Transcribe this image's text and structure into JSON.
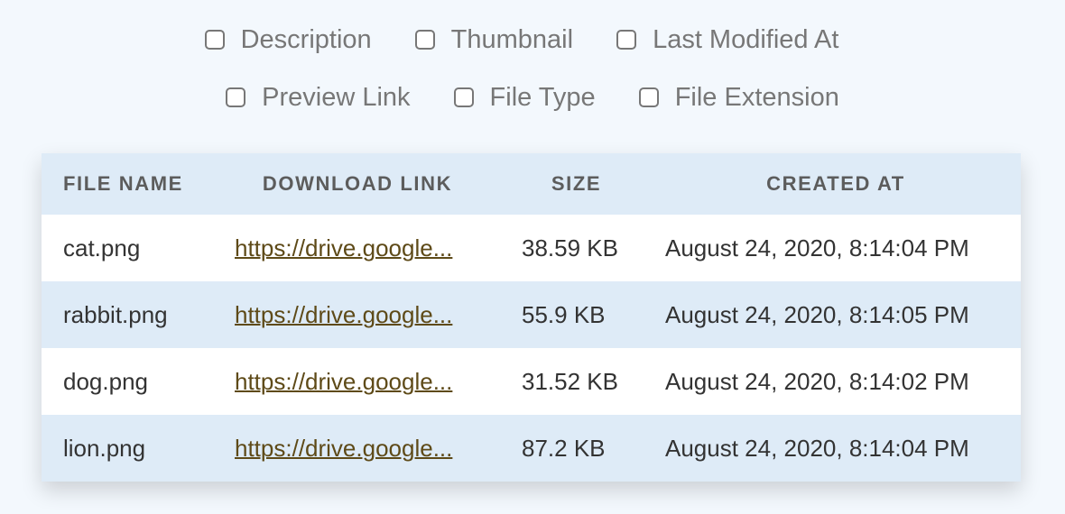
{
  "column_options": {
    "row1": [
      {
        "label": "Description",
        "checked": false
      },
      {
        "label": "Thumbnail",
        "checked": false
      },
      {
        "label": "Last Modified At",
        "checked": false
      }
    ],
    "row2": [
      {
        "label": "Preview Link",
        "checked": false
      },
      {
        "label": "File Type",
        "checked": false
      },
      {
        "label": "File Extension",
        "checked": false
      }
    ]
  },
  "table": {
    "headers": [
      "FILE NAME",
      "DOWNLOAD LINK",
      "SIZE",
      "CREATED AT"
    ],
    "rows": [
      {
        "file_name": "cat.png",
        "download_link": "https://drive.google...",
        "size": "38.59 KB",
        "created_at": "August 24, 2020, 8:14:04 PM"
      },
      {
        "file_name": "rabbit.png",
        "download_link": "https://drive.google...",
        "size": "55.9 KB",
        "created_at": "August 24, 2020, 8:14:05 PM"
      },
      {
        "file_name": "dog.png",
        "download_link": "https://drive.google...",
        "size": "31.52 KB",
        "created_at": "August 24, 2020, 8:14:02 PM"
      },
      {
        "file_name": "lion.png",
        "download_link": "https://drive.google...",
        "size": "87.2 KB",
        "created_at": "August 24, 2020, 8:14:04 PM"
      }
    ]
  },
  "colors": {
    "page_background": "#f3f8fd",
    "header_background": "#deebf7",
    "alt_row_background": "#deebf7",
    "link_color": "#5e4a18",
    "option_text": "#777777"
  }
}
